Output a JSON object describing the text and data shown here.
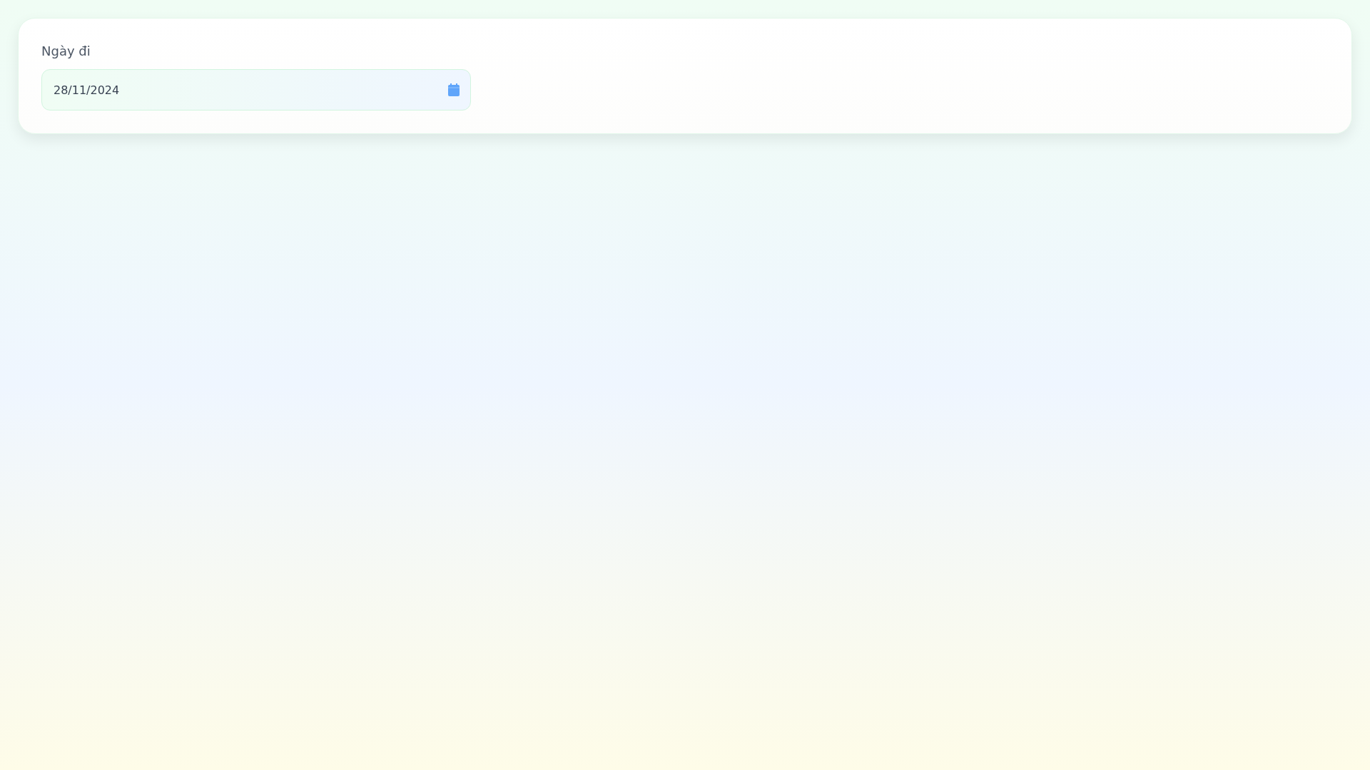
{
  "field": {
    "label": "Ngày đi",
    "value": "28/11/2024"
  }
}
